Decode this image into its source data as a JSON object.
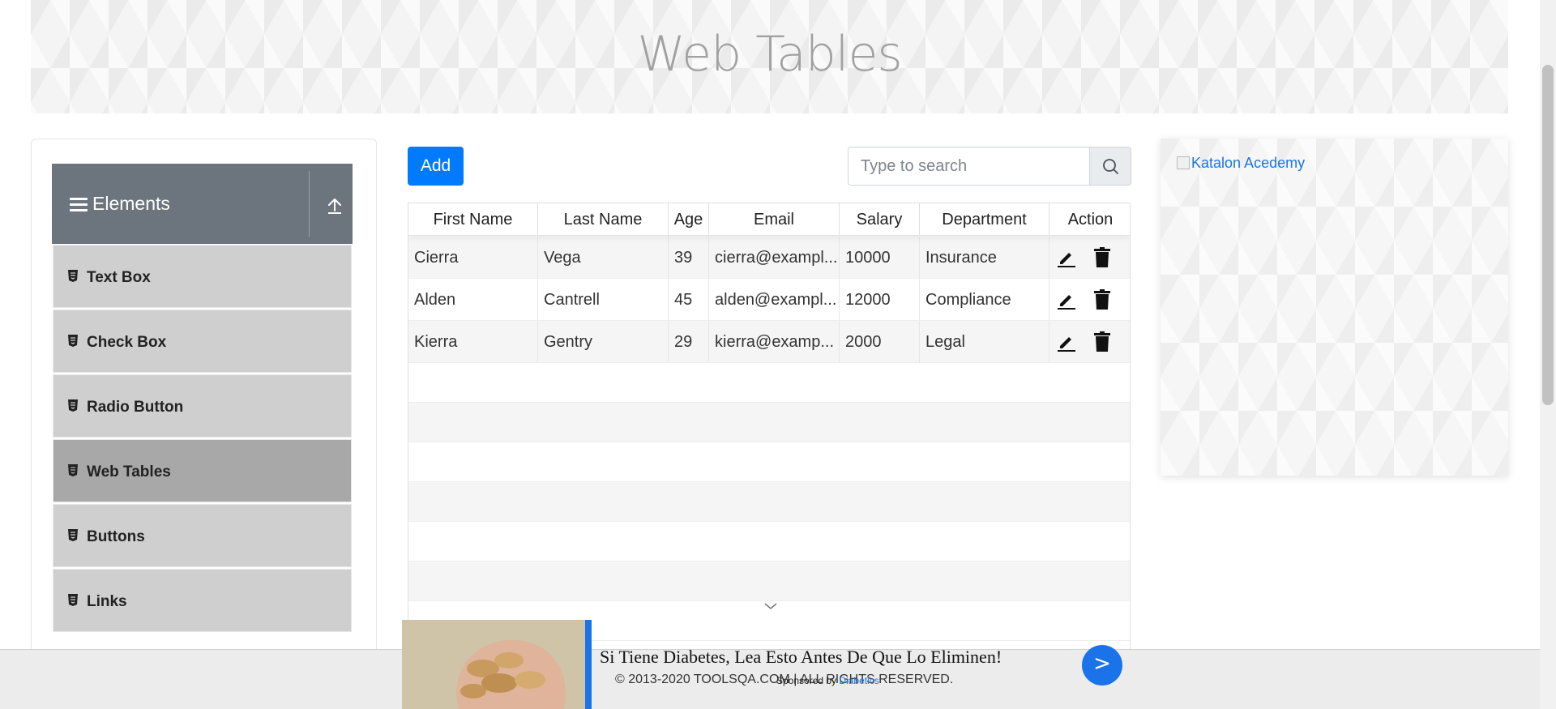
{
  "header": {
    "title": "Web Tables"
  },
  "sidebar": {
    "group_title": "Elements",
    "items": [
      {
        "label": "Text Box",
        "active": false
      },
      {
        "label": "Check Box",
        "active": false
      },
      {
        "label": "Radio Button",
        "active": false
      },
      {
        "label": "Web Tables",
        "active": true
      },
      {
        "label": "Buttons",
        "active": false
      },
      {
        "label": "Links",
        "active": false
      }
    ]
  },
  "toolbar": {
    "add_label": "Add",
    "search_placeholder": "Type to search"
  },
  "table": {
    "columns": [
      "First Name",
      "Last Name",
      "Age",
      "Email",
      "Salary",
      "Department",
      "Action"
    ],
    "rows": [
      {
        "first_name": "Cierra",
        "last_name": "Vega",
        "age": "39",
        "email": "cierra@exampl...",
        "salary": "10000",
        "department": "Insurance"
      },
      {
        "first_name": "Alden",
        "last_name": "Cantrell",
        "age": "45",
        "email": "alden@exampl...",
        "salary": "12000",
        "department": "Compliance"
      },
      {
        "first_name": "Kierra",
        "last_name": "Gentry",
        "age": "29",
        "email": "kierra@examp...",
        "salary": "2000",
        "department": "Legal"
      }
    ]
  },
  "side_ad": {
    "alt_text": "Katalon Acedemy"
  },
  "footer": {
    "text": "© 2013-2020 TOOLSQA.COM | ALL RIGHTS RESERVED."
  },
  "bottom_ad": {
    "headline": "Si Tiene Diabetes, Lea Esto Antes De Que Lo Eliminen!",
    "sponsored_prefix": "Sponsored by",
    "sponsored_brand": "Diabetics",
    "go_label": ">"
  },
  "colors": {
    "accent": "#007bff",
    "sidebar_header": "#6c757d",
    "active_item": "#a8a8a8",
    "ad_blue": "#1a73e8"
  }
}
